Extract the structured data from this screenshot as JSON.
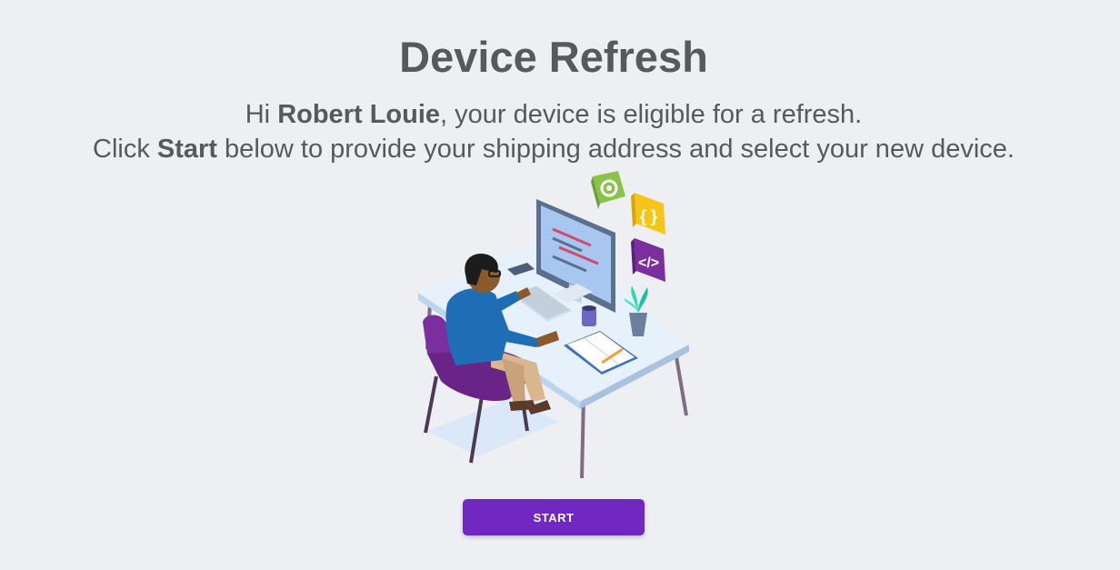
{
  "header": {
    "title": "Device Refresh"
  },
  "message": {
    "line1_prefix": "Hi ",
    "user_name": "Robert Louie",
    "line1_suffix": ", your device is eligible for a refresh.",
    "line2_prefix": "Click ",
    "line2_bold": "Start",
    "line2_suffix": " below to provide your shipping address and select your new device."
  },
  "illustration": {
    "icon": "person-working-at-desk-illustration"
  },
  "actions": {
    "start_label": "START"
  },
  "colors": {
    "background": "#eeeff2",
    "text": "#58595b",
    "button": "#7127c2",
    "chair": "#7b2f9e"
  }
}
